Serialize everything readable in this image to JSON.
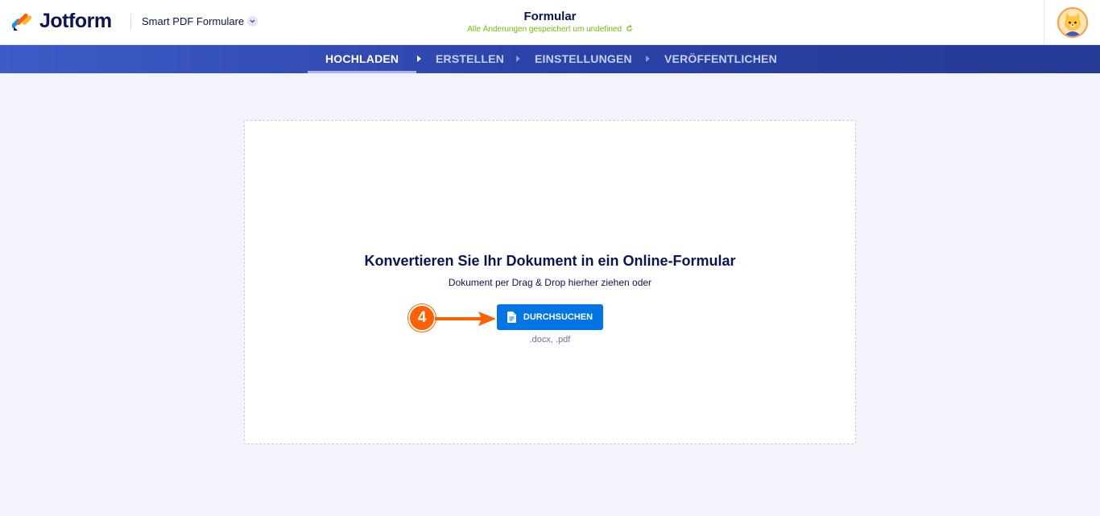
{
  "header": {
    "brand": "Jotform",
    "product_switcher": "Smart PDF Formulare",
    "form_title": "Formular",
    "save_status": "Alle Änderungen gespeichert um undefined"
  },
  "nav": {
    "items": [
      {
        "label": "HOCHLADEN",
        "active": true
      },
      {
        "label": "ERSTELLEN",
        "active": false
      },
      {
        "label": "EINSTELLUNGEN",
        "active": false
      },
      {
        "label": "VERÖFFENTLICHEN",
        "active": false
      }
    ]
  },
  "upload": {
    "title": "Konvertieren Sie Ihr Dokument in ein Online-Formular",
    "subtitle": "Dokument per Drag & Drop hierher ziehen oder",
    "browse_label": "DURCHSUCHEN",
    "file_types": ".docx, .pdf"
  },
  "annotation": {
    "step_number": "4"
  },
  "colors": {
    "brand_navy": "#0a1551",
    "primary_button": "#0075e3",
    "nav_gradient_start": "#3e5bc7",
    "nav_gradient_end": "#243a93",
    "save_status": "#78bb07",
    "annotation": "#ff6100"
  },
  "icons": {
    "logo": "jotform-logo-icon",
    "chevron": "chevron-down-icon",
    "refresh": "refresh-icon",
    "avatar": "avatar-icon",
    "document": "document-icon",
    "nav_separator": "caret-right-icon"
  }
}
